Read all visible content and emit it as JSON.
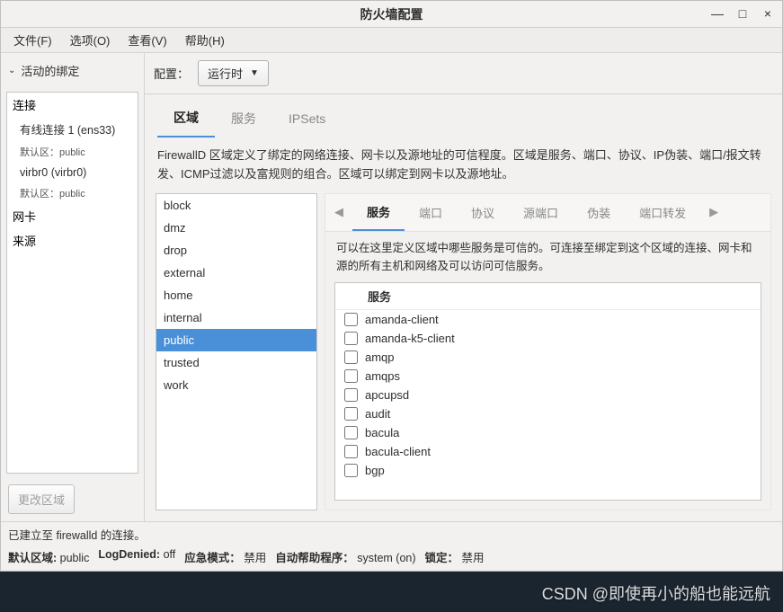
{
  "window": {
    "title": "防火墙配置"
  },
  "menu": {
    "file": "文件(F)",
    "options": "选项(O)",
    "view": "查看(V)",
    "help": "帮助(H)"
  },
  "toolbar": {
    "config_label": "配置：",
    "config_value": "运行时"
  },
  "left": {
    "header": "活动的绑定",
    "connections_label": "连接",
    "conn1_name": "有线连接 1 (ens33)",
    "conn1_zone": "默认区：public",
    "conn2_name": "virbr0 (virbr0)",
    "conn2_zone": "默认区：public",
    "interfaces_label": "网卡",
    "sources_label": "来源",
    "change_zone_btn": "更改区域"
  },
  "tabs": {
    "zone": "区域",
    "service": "服务",
    "ipsets": "IPSets"
  },
  "zone_desc": "FirewallD 区域定义了绑定的网络连接、网卡以及源地址的可信程度。区域是服务、端口、协议、IP伪装、端口/报文转发、ICMP过滤以及富规则的组合。区域可以绑定到网卡以及源地址。",
  "zones": [
    "block",
    "dmz",
    "drop",
    "external",
    "home",
    "internal",
    "public",
    "trusted",
    "work"
  ],
  "zone_selected": "public",
  "detail_tabs": {
    "services": "服务",
    "ports": "端口",
    "protocols": "协议",
    "source_ports": "源端口",
    "masquerade": "伪装",
    "port_forward": "端口转发"
  },
  "detail_desc": "可以在这里定义区域中哪些服务是可信的。可连接至绑定到这个区域的连接、网卡和源的所有主机和网络及可以访问可信服务。",
  "service_header": "服务",
  "services": [
    "amanda-client",
    "amanda-k5-client",
    "amqp",
    "amqps",
    "apcupsd",
    "audit",
    "bacula",
    "bacula-client",
    "bgp"
  ],
  "status": {
    "line1": "已建立至 firewalld 的连接。",
    "default_zone_label": "默认区域:",
    "default_zone_value": "public",
    "log_denied_label": "LogDenied:",
    "log_denied_value": "off",
    "panic_label": "应急模式：",
    "panic_value": "禁用",
    "auto_helper_label": "自动帮助程序：",
    "auto_helper_value": "system (on)",
    "lockdown_label": "锁定：",
    "lockdown_value": "禁用"
  },
  "watermark": "CSDN @即使再小的船也能远航"
}
